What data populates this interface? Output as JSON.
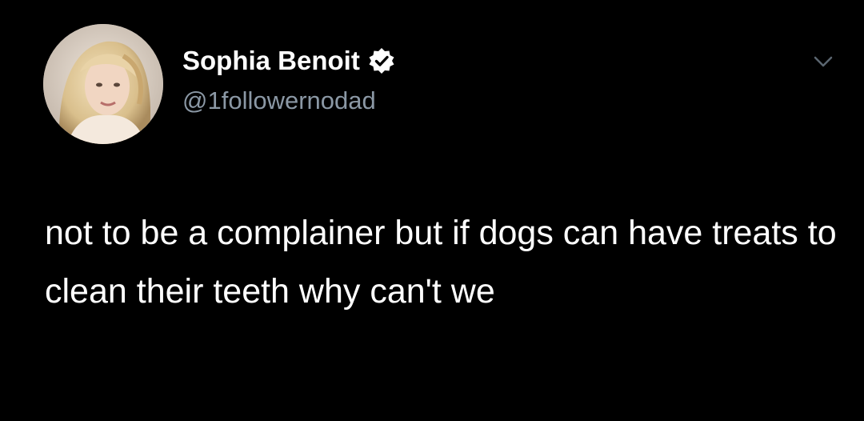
{
  "author": {
    "display_name": "Sophia Benoit",
    "handle": "@1followernodad",
    "verified": true,
    "avatar_icon": "profile-photo",
    "verified_icon": "verified-badge-icon"
  },
  "tweet": {
    "text": "not to be a complainer but if dogs can have treats to clean their teeth why can't we"
  },
  "menu": {
    "icon": "chevron-down-icon"
  },
  "colors": {
    "background": "#000000",
    "name": "#ffffff",
    "handle": "#8b98a5",
    "text": "#ffffff",
    "badge": "#ffffff"
  }
}
